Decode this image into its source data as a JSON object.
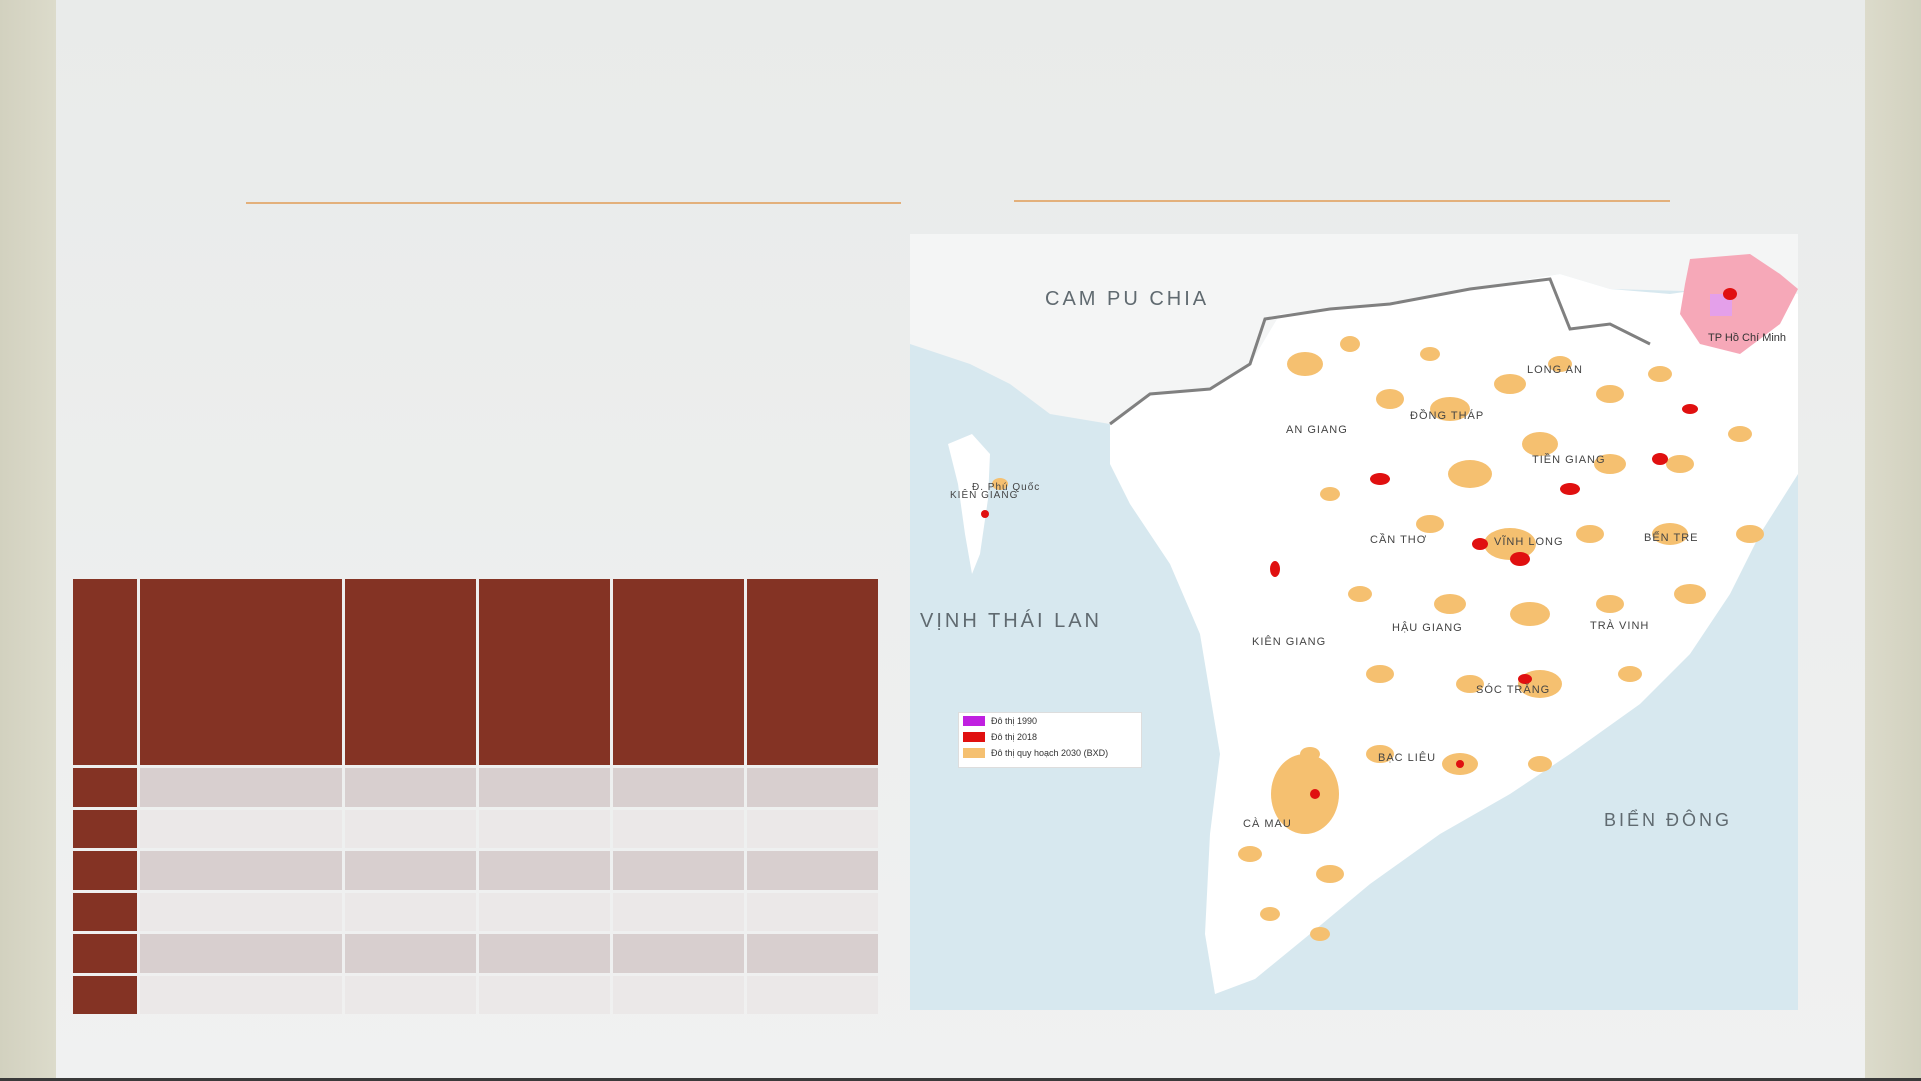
{
  "slide": {
    "background_color": "#eeefef",
    "accent_rule_color": "#e3b07b"
  },
  "table": {
    "header_color": "#843324",
    "row_colors": [
      "#d8cfcf",
      "#ebe8e8"
    ],
    "columns": [
      "",
      "",
      "",
      "",
      "",
      ""
    ],
    "rows": [
      [
        "",
        "",
        "",
        "",
        "",
        ""
      ],
      [
        "",
        "",
        "",
        "",
        "",
        ""
      ],
      [
        "",
        "",
        "",
        "",
        "",
        ""
      ],
      [
        "",
        "",
        "",
        "",
        "",
        ""
      ],
      [
        "",
        "",
        "",
        "",
        "",
        ""
      ],
      [
        "",
        "",
        "",
        "",
        "",
        ""
      ]
    ]
  },
  "map": {
    "labels": {
      "cambodia": "CAM PU CHIA",
      "gulf": "VỊNH THÁI LAN",
      "east_sea": "BIỂN ĐÔNG",
      "hcmc": "TP Hồ Chí Minh",
      "phu_quoc": "Đ. Phú Quốc",
      "kien_giang_island": "KIÊN GIANG",
      "long_an": "LONG AN",
      "dong_thap": "ĐỒNG THÁP",
      "an_giang": "AN GIANG",
      "tien_giang": "TIỀN GIANG",
      "can_tho": "CẦN THƠ",
      "vinh_long": "VĨNH LONG",
      "ben_tre": "BẾN TRE",
      "kien_giang": "KIÊN GIANG",
      "hau_giang": "HẬU GIANG",
      "tra_vinh": "TRÀ VINH",
      "soc_trang": "SÓC TRĂNG",
      "bac_lieu": "BẠC LIÊU",
      "ca_mau": "CÀ MAU"
    },
    "legend": [
      {
        "label": "Đô thị 1990",
        "color": "#c020e0"
      },
      {
        "label": "Đô thị 2018",
        "color": "#e01010"
      },
      {
        "label": "Đô thị quy hoạch 2030 (BXD)",
        "color": "#f5c070"
      }
    ],
    "colors": {
      "sea": "#d7e8ef",
      "land": "#ffffff",
      "border": "#808080",
      "planned_urban": "#f5c070",
      "urban_2018": "#e01010",
      "hcmc_area": "#f6a8b8"
    }
  }
}
